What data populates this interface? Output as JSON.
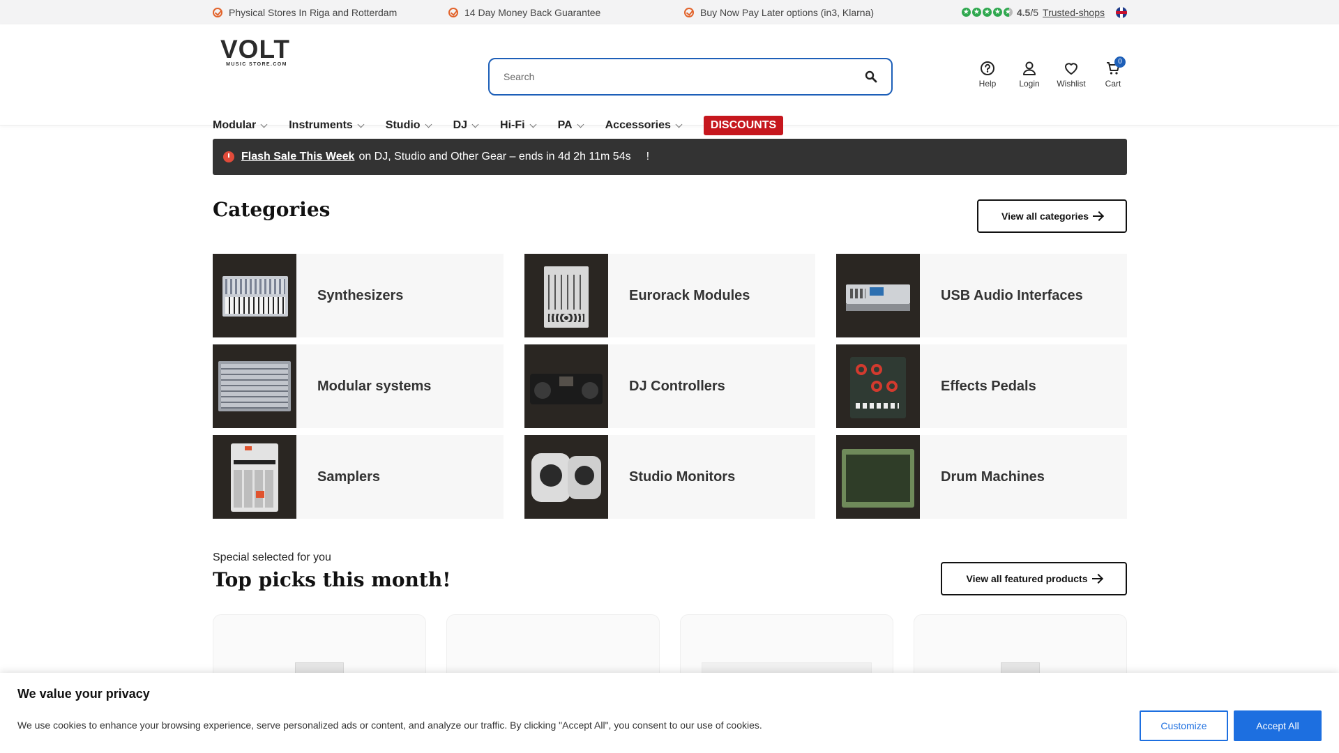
{
  "topbar": {
    "usps": [
      "Physical Stores In Riga and Rotterdam",
      "14 Day Money Back Guarantee",
      "Buy Now Pay Later options (in3, Klarna)"
    ],
    "rating_score": "4.5",
    "rating_suffix": "/5",
    "rating_link": "Trusted-shops",
    "stars": 4.5
  },
  "header": {
    "logo_main": "VOLT",
    "logo_sub": "MUSIC STORE.COM",
    "search_placeholder": "Search",
    "actions": {
      "help": "Help",
      "login": "Login",
      "wishlist": "Wishlist",
      "cart": "Cart",
      "cart_count": "0"
    }
  },
  "nav": {
    "items": [
      "Modular",
      "Instruments",
      "Studio",
      "DJ",
      "Hi-Fi",
      "PA",
      "Accessories"
    ],
    "discounts": "DISCOUNTS"
  },
  "flash": {
    "link": "Flash Sale This Week",
    "text": "on DJ, Studio and Other Gear – ends in 4d 2h 11m 54s",
    "end": "!"
  },
  "categories": {
    "title": "Categories",
    "view_all": "View all categories",
    "items": [
      "Synthesizers",
      "Eurorack Modules",
      "USB Audio Interfaces",
      "Modular systems",
      "DJ Controllers",
      "Effects Pedals",
      "Samplers",
      "Studio Monitors",
      "Drum Machines"
    ]
  },
  "top_picks": {
    "subtitle": "Special selected for you",
    "title": "Top picks this month!",
    "view_all": "View all featured products"
  },
  "cookie": {
    "title": "We value your privacy",
    "text": "We use cookies to enhance your browsing experience, serve personalized ads or content, and analyze our traffic. By clicking \"Accept All\", you consent to our use of cookies.",
    "customize": "Customize",
    "accept": "Accept All"
  },
  "colors": {
    "accent_blue": "#1d6fe0",
    "discount_red": "#c6171e",
    "usp_orange": "#e2632b",
    "rating_green": "#2fa84f"
  }
}
